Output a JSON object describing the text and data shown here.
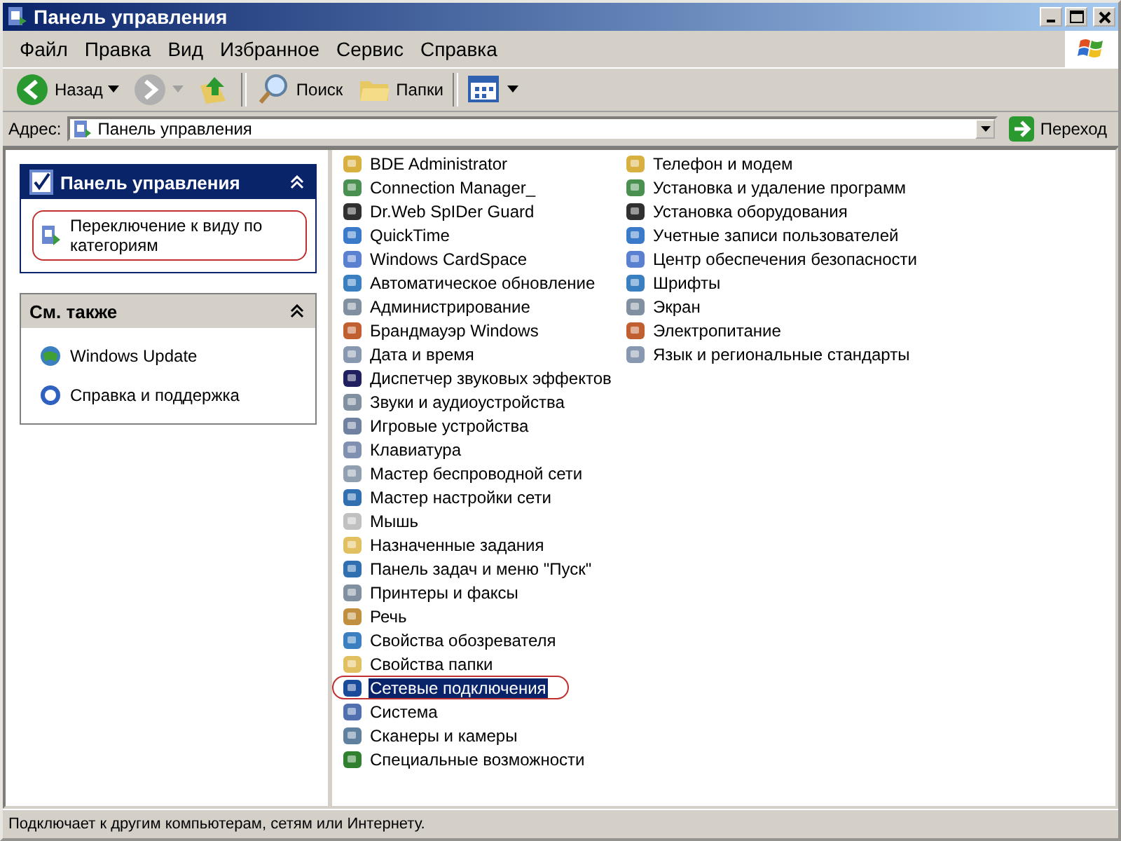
{
  "window": {
    "title": "Панель управления"
  },
  "menu": [
    "Файл",
    "Правка",
    "Вид",
    "Избранное",
    "Сервис",
    "Справка"
  ],
  "toolbar": [
    {
      "kind": "back",
      "label": "Назад",
      "disabled": false
    },
    {
      "kind": "forward",
      "disabled": true
    },
    {
      "kind": "up",
      "disabled": false
    },
    {
      "kind": "search",
      "label": "Поиск",
      "disabled": false
    },
    {
      "kind": "folders",
      "label": "Папки",
      "disabled": false
    },
    {
      "kind": "views",
      "disabled": false
    }
  ],
  "address": {
    "label": "Адрес:",
    "value": "Панель управления",
    "go": "Переход"
  },
  "task_panes": [
    {
      "title": "Панель управления",
      "kind": "primary",
      "expanded": true,
      "links": [
        {
          "text": "Переключение к виду по категориям",
          "circled": true
        }
      ]
    },
    {
      "title": "См. также",
      "kind": "secondary",
      "expanded": true,
      "links": [
        {
          "text": "Windows Update",
          "circled": false
        },
        {
          "text": "Справка и поддержка",
          "circled": false
        }
      ]
    }
  ],
  "applets": [
    {
      "label": "BDE Administrator",
      "selected": false,
      "circled": false
    },
    {
      "label": "Connection Manager_",
      "selected": false,
      "circled": false
    },
    {
      "label": "Dr.Web SpIDer Guard",
      "selected": false,
      "circled": false
    },
    {
      "label": "QuickTime",
      "selected": false,
      "circled": false
    },
    {
      "label": "Windows CardSpace",
      "selected": false,
      "circled": false
    },
    {
      "label": "Автоматическое обновление",
      "selected": false,
      "circled": false
    },
    {
      "label": "Администрирование",
      "selected": false,
      "circled": false
    },
    {
      "label": "Брандмауэр Windows",
      "selected": false,
      "circled": false
    },
    {
      "label": "Дата и время",
      "selected": false,
      "circled": false
    },
    {
      "label": "Диспетчер звуковых эффектов",
      "selected": false,
      "circled": false
    },
    {
      "label": "Звуки и аудиоустройства",
      "selected": false,
      "circled": false
    },
    {
      "label": "Игровые устройства",
      "selected": false,
      "circled": false
    },
    {
      "label": "Клавиатура",
      "selected": false,
      "circled": false
    },
    {
      "label": "Мастер беспроводной сети",
      "selected": false,
      "circled": false
    },
    {
      "label": "Мастер настройки сети",
      "selected": false,
      "circled": false
    },
    {
      "label": "Мышь",
      "selected": false,
      "circled": false
    },
    {
      "label": "Назначенные задания",
      "selected": false,
      "circled": false
    },
    {
      "label": "Панель задач и меню \"Пуск\"",
      "selected": false,
      "circled": false
    },
    {
      "label": "Принтеры и факсы",
      "selected": false,
      "circled": false
    },
    {
      "label": "Речь",
      "selected": false,
      "circled": false
    },
    {
      "label": "Свойства обозревателя",
      "selected": false,
      "circled": false
    },
    {
      "label": "Свойства папки",
      "selected": false,
      "circled": false
    },
    {
      "label": "Сетевые подключения",
      "selected": true,
      "circled": true
    },
    {
      "label": "Система",
      "selected": false,
      "circled": false
    },
    {
      "label": "Сканеры и камеры",
      "selected": false,
      "circled": false
    },
    {
      "label": "Специальные возможности",
      "selected": false,
      "circled": false
    },
    {
      "label": "Телефон и модем",
      "selected": false,
      "circled": false
    },
    {
      "label": "Установка и удаление программ",
      "selected": false,
      "circled": false
    },
    {
      "label": "Установка оборудования",
      "selected": false,
      "circled": false
    },
    {
      "label": "Учетные записи пользователей",
      "selected": false,
      "circled": false
    },
    {
      "label": "Центр обеспечения безопасности",
      "selected": false,
      "circled": false
    },
    {
      "label": "Шрифты",
      "selected": false,
      "circled": false
    },
    {
      "label": "Экран",
      "selected": false,
      "circled": false
    },
    {
      "label": "Электропитание",
      "selected": false,
      "circled": false
    },
    {
      "label": "Язык и региональные стандарты",
      "selected": false,
      "circled": false
    }
  ],
  "status_bar": {
    "text": "Подключает к другим компьютерам, сетям или Интернету."
  }
}
